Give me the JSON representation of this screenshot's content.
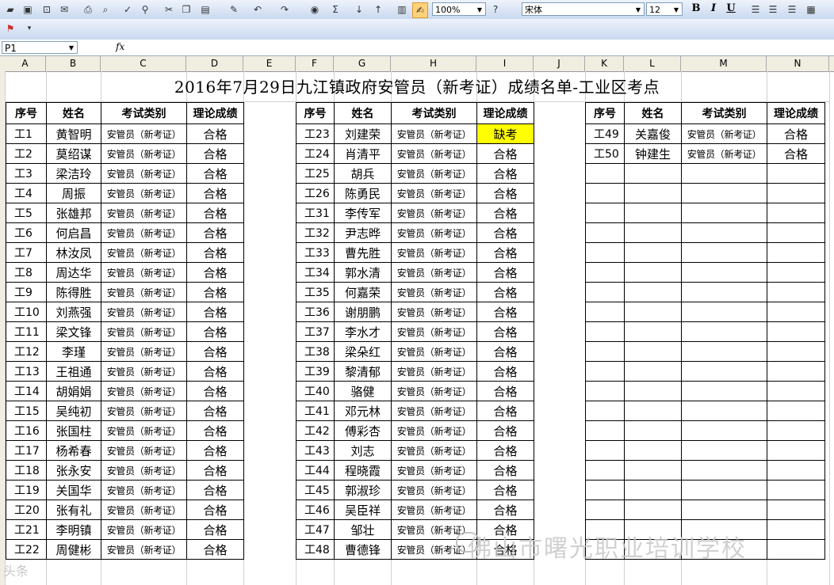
{
  "toolbar": {
    "zoom": "100%",
    "font_name": "宋体",
    "font_size": "12",
    "bold": "B",
    "italic": "I",
    "underline": "U",
    "sigma": "Σ"
  },
  "formula_bar": {
    "cell_ref": "P1",
    "fx": "fx",
    "content": ""
  },
  "columns": [
    "A",
    "B",
    "C",
    "D",
    "E",
    "F",
    "G",
    "H",
    "I",
    "J",
    "K",
    "L",
    "M",
    "N"
  ],
  "sheet": {
    "title": "2016年7月29日九江镇政府安管员（新考证）成绩名单-工业区考点",
    "headers": [
      "序号",
      "姓名",
      "考试类别",
      "理论成绩"
    ],
    "block1": [
      [
        "工1",
        "黄智明",
        "安管员（新考证）",
        "合格"
      ],
      [
        "工2",
        "莫绍谋",
        "安管员（新考证）",
        "合格"
      ],
      [
        "工3",
        "梁洁玲",
        "安管员（新考证）",
        "合格"
      ],
      [
        "工4",
        "周振",
        "安管员（新考证）",
        "合格"
      ],
      [
        "工5",
        "张雄邦",
        "安管员（新考证）",
        "合格"
      ],
      [
        "工6",
        "何启昌",
        "安管员（新考证）",
        "合格"
      ],
      [
        "工7",
        "林汝凤",
        "安管员（新考证）",
        "合格"
      ],
      [
        "工8",
        "周达华",
        "安管员（新考证）",
        "合格"
      ],
      [
        "工9",
        "陈得胜",
        "安管员（新考证）",
        "合格"
      ],
      [
        "工10",
        "刘燕强",
        "安管员（新考证）",
        "合格"
      ],
      [
        "工11",
        "梁文锋",
        "安管员（新考证）",
        "合格"
      ],
      [
        "工12",
        "李瑾",
        "安管员（新考证）",
        "合格"
      ],
      [
        "工13",
        "王祖通",
        "安管员（新考证）",
        "合格"
      ],
      [
        "工14",
        "胡娟娟",
        "安管员（新考证）",
        "合格"
      ],
      [
        "工15",
        "吴纯初",
        "安管员（新考证）",
        "合格"
      ],
      [
        "工16",
        "张国柱",
        "安管员（新考证）",
        "合格"
      ],
      [
        "工17",
        "杨希春",
        "安管员（新考证）",
        "合格"
      ],
      [
        "工18",
        "张永安",
        "安管员（新考证）",
        "合格"
      ],
      [
        "工19",
        "关国华",
        "安管员（新考证）",
        "合格"
      ],
      [
        "工20",
        "张有礼",
        "安管员（新考证）",
        "合格"
      ],
      [
        "工21",
        "李明镇",
        "安管员（新考证）",
        "合格"
      ],
      [
        "工22",
        "周健彬",
        "安管员（新考证）",
        "合格"
      ]
    ],
    "block2": [
      [
        "工23",
        "刘建荣",
        "安管员（新考证）",
        "缺考"
      ],
      [
        "工24",
        "肖清平",
        "安管员（新考证）",
        "合格"
      ],
      [
        "工25",
        "胡兵",
        "安管员（新考证）",
        "合格"
      ],
      [
        "工26",
        "陈勇民",
        "安管员（新考证）",
        "合格"
      ],
      [
        "工31",
        "李传军",
        "安管员（新考证）",
        "合格"
      ],
      [
        "工32",
        "尹志晔",
        "安管员（新考证）",
        "合格"
      ],
      [
        "工33",
        "曹先胜",
        "安管员（新考证）",
        "合格"
      ],
      [
        "工34",
        "郭水清",
        "安管员（新考证）",
        "合格"
      ],
      [
        "工35",
        "何嘉荣",
        "安管员（新考证）",
        "合格"
      ],
      [
        "工36",
        "谢朋鹏",
        "安管员（新考证）",
        "合格"
      ],
      [
        "工37",
        "李水才",
        "安管员（新考证）",
        "合格"
      ],
      [
        "工38",
        "梁朵红",
        "安管员（新考证）",
        "合格"
      ],
      [
        "工39",
        "黎清郁",
        "安管员（新考证）",
        "合格"
      ],
      [
        "工40",
        "骆健",
        "安管员（新考证）",
        "合格"
      ],
      [
        "工41",
        "邓元林",
        "安管员（新考证）",
        "合格"
      ],
      [
        "工42",
        "傅彩杏",
        "安管员（新考证）",
        "合格"
      ],
      [
        "工43",
        "刘志",
        "安管员（新考证）",
        "合格"
      ],
      [
        "工44",
        "程晓霞",
        "安管员（新考证）",
        "合格"
      ],
      [
        "工45",
        "郭淑珍",
        "安管员（新考证）",
        "合格"
      ],
      [
        "工46",
        "吴臣祥",
        "安管员（新考证）",
        "合格"
      ],
      [
        "工47",
        "邹壮",
        "安管员（新考证）",
        "合格"
      ],
      [
        "工48",
        "曹德锋",
        "安管员（新考证）",
        "合格"
      ]
    ],
    "block3": [
      [
        "工49",
        "关嘉俊",
        "安管员（新考证）",
        "合格"
      ],
      [
        "工50",
        "钟建生",
        "安管员（新考证）",
        "合格"
      ]
    ],
    "highlight_color": "#ffff00"
  },
  "watermark": {
    "text": "佛山市曙光职业培训学校",
    "corner": "头条"
  }
}
